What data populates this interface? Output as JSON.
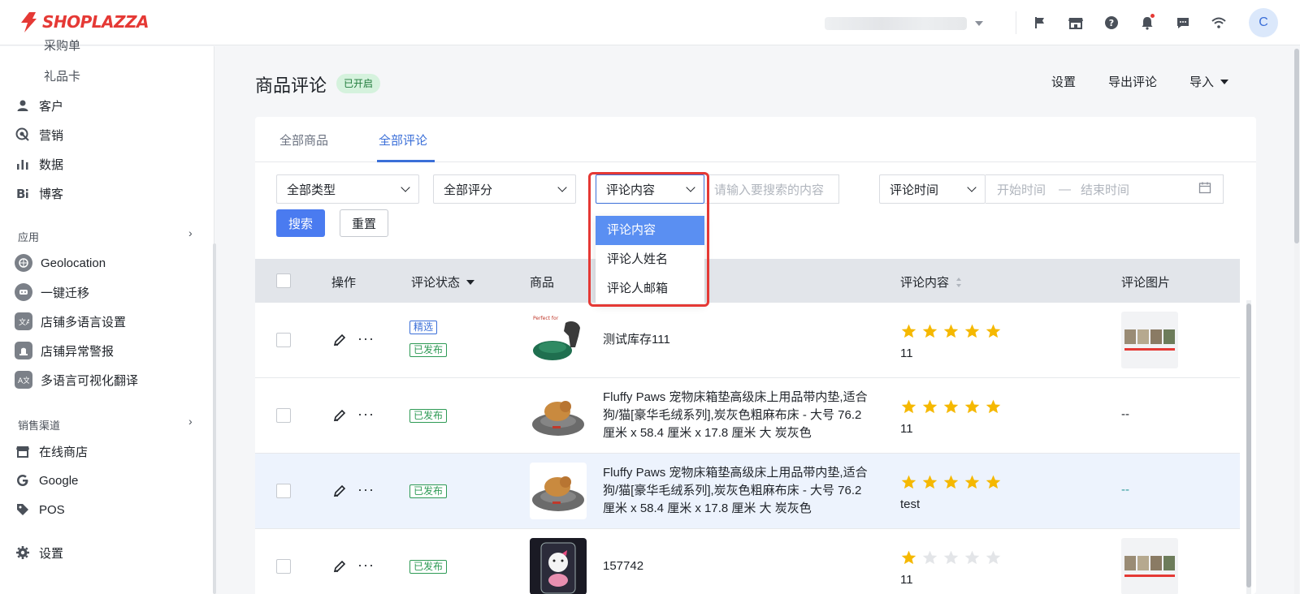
{
  "brand": {
    "logo_text": "SHOPLAZZA",
    "accent": "#e53935"
  },
  "topbar": {
    "icons": [
      "flag-icon",
      "store-icon",
      "help-icon",
      "bell-icon",
      "chat-icon",
      "wifi-icon"
    ],
    "avatar": "C"
  },
  "sidebar": {
    "partial_item": "采购单",
    "sub_item": "礼品卡",
    "nav": [
      {
        "label": "客户",
        "icon": "person-icon"
      },
      {
        "label": "营销",
        "icon": "target-icon"
      },
      {
        "label": "数据",
        "icon": "bar-chart-icon"
      },
      {
        "label": "博客",
        "icon": "blog-icon"
      }
    ],
    "apps_title": "应用",
    "apps": [
      {
        "label": "Geolocation",
        "icon": "geolocation-icon"
      },
      {
        "label": "一键迁移",
        "icon": "migrate-icon"
      },
      {
        "label": "店铺多语言设置",
        "icon": "language-icon"
      },
      {
        "label": "店铺异常警报",
        "icon": "alarm-icon"
      },
      {
        "label": "多语言可视化翻译",
        "icon": "translate-icon"
      }
    ],
    "channels_title": "销售渠道",
    "channels": [
      {
        "label": "在线商店",
        "icon": "store-icon"
      },
      {
        "label": "Google",
        "icon": "google-icon"
      },
      {
        "label": "POS",
        "icon": "tag-icon"
      }
    ],
    "settings": "设置"
  },
  "header": {
    "title": "商品评论",
    "status": "已开启",
    "actions": {
      "settings": "设置",
      "export": "导出评论",
      "import": "导入"
    }
  },
  "tabs": [
    {
      "label": "全部商品",
      "active": false
    },
    {
      "label": "全部评论",
      "active": true
    }
  ],
  "filters": {
    "type": "全部类型",
    "rating": "全部评分",
    "search_field": "评论内容",
    "search_placeholder": "请输入要搜索的内容",
    "time_field": "评论时间",
    "start_placeholder": "开始时间",
    "range_sep": "—",
    "end_placeholder": "结束时间",
    "search_button": "搜索",
    "reset_button": "重置"
  },
  "dropdown": {
    "options": [
      "评论内容",
      "评论人姓名",
      "评论人邮箱"
    ],
    "selected": 0
  },
  "table": {
    "columns": {
      "action": "操作",
      "status": "评论状态",
      "product": "商品",
      "content": "评论内容",
      "images": "评论图片"
    },
    "tag_featured": "精选",
    "tag_published": "已发布",
    "empty": "--",
    "rows": [
      {
        "product": "测试库存111",
        "stars": 5,
        "text": "11",
        "featured": true,
        "has_image": true
      },
      {
        "product": "Fluffy Paws 宠物床箱垫高级床上用品带内垫,适合狗/猫[豪华毛绒系列],炭灰色粗麻布床 - 大号 76.2 厘米 x 58.4 厘米 x 17.8 厘米 大 炭灰色",
        "stars": 5,
        "text": "11",
        "featured": false,
        "has_image": false
      },
      {
        "product": "Fluffy Paws 宠物床箱垫高级床上用品带内垫,适合狗/猫[豪华毛绒系列],炭灰色粗麻布床 - 大号 76.2 厘米 x 58.4 厘米 x 17.8 厘米 大 炭灰色",
        "stars": 5,
        "text": "test",
        "featured": false,
        "has_image": false
      },
      {
        "product": "157742",
        "stars": 1,
        "text": "11",
        "featured": false,
        "has_image": true
      }
    ]
  },
  "colors": {
    "primary": "#4a7bf0",
    "star": "#f5b800",
    "star_empty": "#e3e5e8",
    "published": "#2e9a55",
    "highlight": "#e53935"
  }
}
